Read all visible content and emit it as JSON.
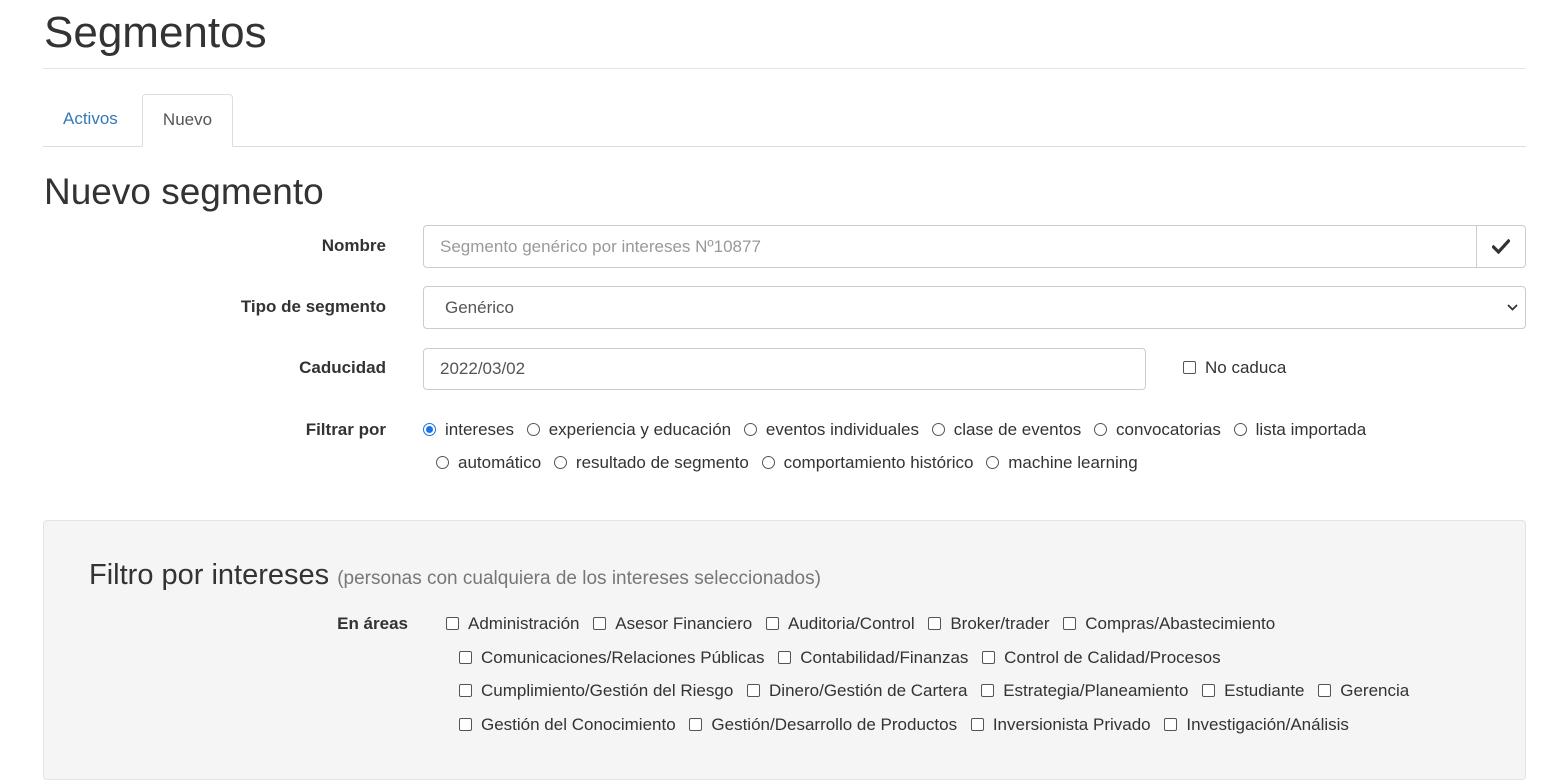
{
  "page": {
    "title": "Segmentos"
  },
  "tabs": [
    {
      "label": "Activos"
    },
    {
      "label": "Nuevo"
    }
  ],
  "form": {
    "title": "Nuevo segmento",
    "nombre": {
      "label": "Nombre",
      "placeholder": "Segmento genérico por intereses Nº10877",
      "value": ""
    },
    "tipo": {
      "label": "Tipo de segmento",
      "selected": "Genérico"
    },
    "caducidad": {
      "label": "Caducidad",
      "value": "2022/03/02",
      "no_caduca_label": "No caduca",
      "no_caduca_checked": false
    },
    "filtrar": {
      "label": "Filtrar por",
      "selected": "intereses",
      "options": [
        "intereses",
        "experiencia y educación",
        "eventos individuales",
        "clase de eventos",
        "convocatorias",
        "lista importada",
        "automático",
        "resultado de segmento",
        "comportamiento histórico",
        "machine learning"
      ]
    }
  },
  "panel": {
    "title": "Filtro por intereses",
    "subtitle": "(personas con cualquiera de los intereses seleccionados)",
    "areas_label": "En áreas",
    "areas": [
      "Administración",
      "Asesor Financiero",
      "Auditoria/Control",
      "Broker/trader",
      "Compras/Abastecimiento",
      "Comunicaciones/Relaciones Públicas",
      "Contabilidad/Finanzas",
      "Control de Calidad/Procesos",
      "Cumplimiento/Gestión del Riesgo",
      "Dinero/Gestión de Cartera",
      "Estrategia/Planeamiento",
      "Estudiante",
      "Gerencia",
      "Gestión del Conocimiento",
      "Gestión/Desarrollo de Productos",
      "Inversionista Privado",
      "Investigación/Análisis"
    ]
  },
  "colors": {
    "link": "#337ab7",
    "radio_selected": "#1a73e8",
    "panel_bg": "#f5f5f5"
  },
  "icons": {
    "confirm": "checkmark-icon",
    "select": "chevron-down-icon"
  }
}
